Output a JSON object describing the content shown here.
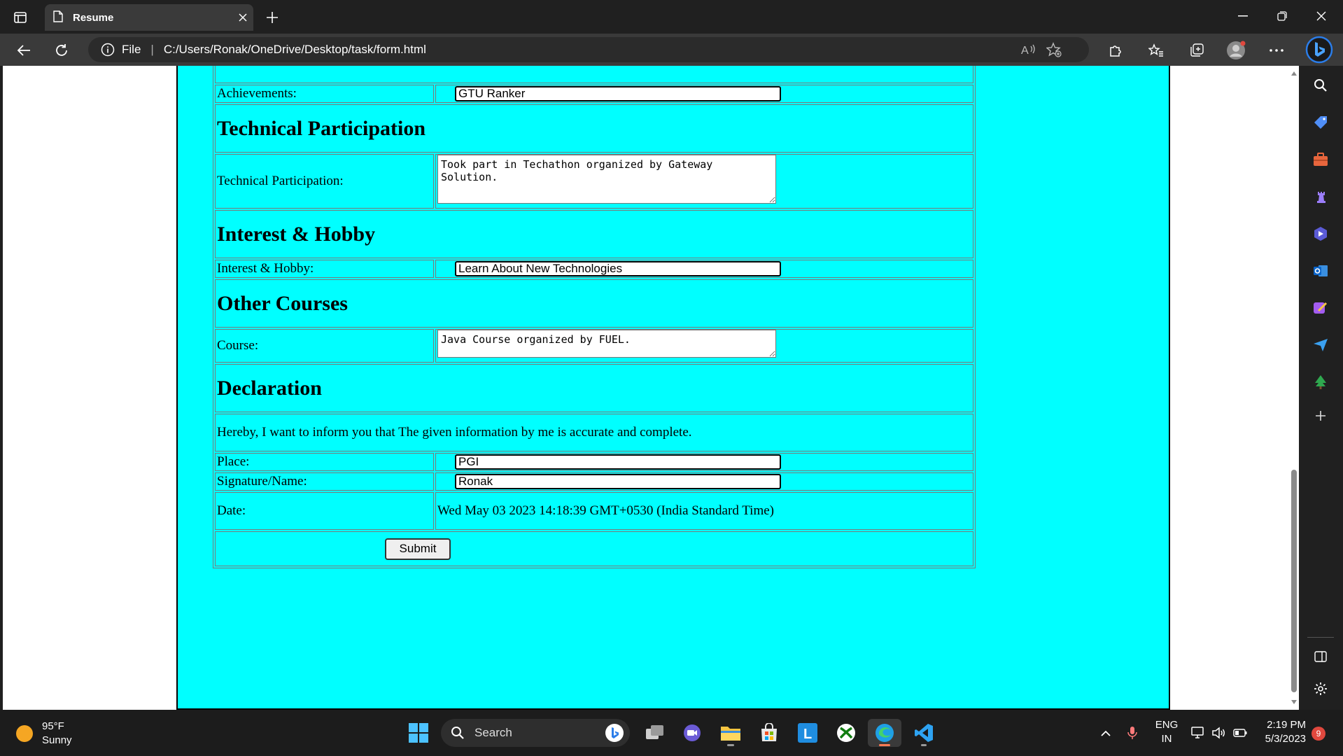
{
  "browser": {
    "tab_title": "Resume",
    "address_prefix": "File",
    "url": "C:/Users/Ronak/OneDrive/Desktop/task/form.html"
  },
  "form": {
    "achievements_label": "Achievements:",
    "achievements_value": "GTU Ranker",
    "technical_heading": "Technical Participation",
    "technical_label": "Technical Participation:",
    "technical_value": "Took part in Techathon organized by Gateway Solution.",
    "interest_heading": "Interest & Hobby",
    "interest_label": "Interest & Hobby:",
    "interest_value": "Learn About New Technologies",
    "courses_heading": "Other Courses",
    "course_label": "Course:",
    "course_value": "Java Course organized by FUEL.",
    "declaration_heading": "Declaration",
    "declaration_text": "Hereby, I want to inform you that The given information by me is accurate and complete.",
    "place_label": "Place:",
    "place_value": "PGI",
    "signature_label": "Signature/Name:",
    "signature_value": "Ronak",
    "date_label": "Date:",
    "date_value": "Wed May 03 2023 14:18:39 GMT+0530 (India Standard Time)",
    "submit_label": "Submit"
  },
  "taskbar": {
    "temperature": "95°F",
    "weather": "Sunny",
    "search_label": "Search",
    "lang_top": "ENG",
    "lang_bottom": "IN",
    "time": "2:19 PM",
    "date": "5/3/2023",
    "notification_count": "9"
  },
  "colors": {
    "page_background": "#00ffff",
    "chrome_dark": "#202020",
    "accent_edge": "#0078d4"
  }
}
